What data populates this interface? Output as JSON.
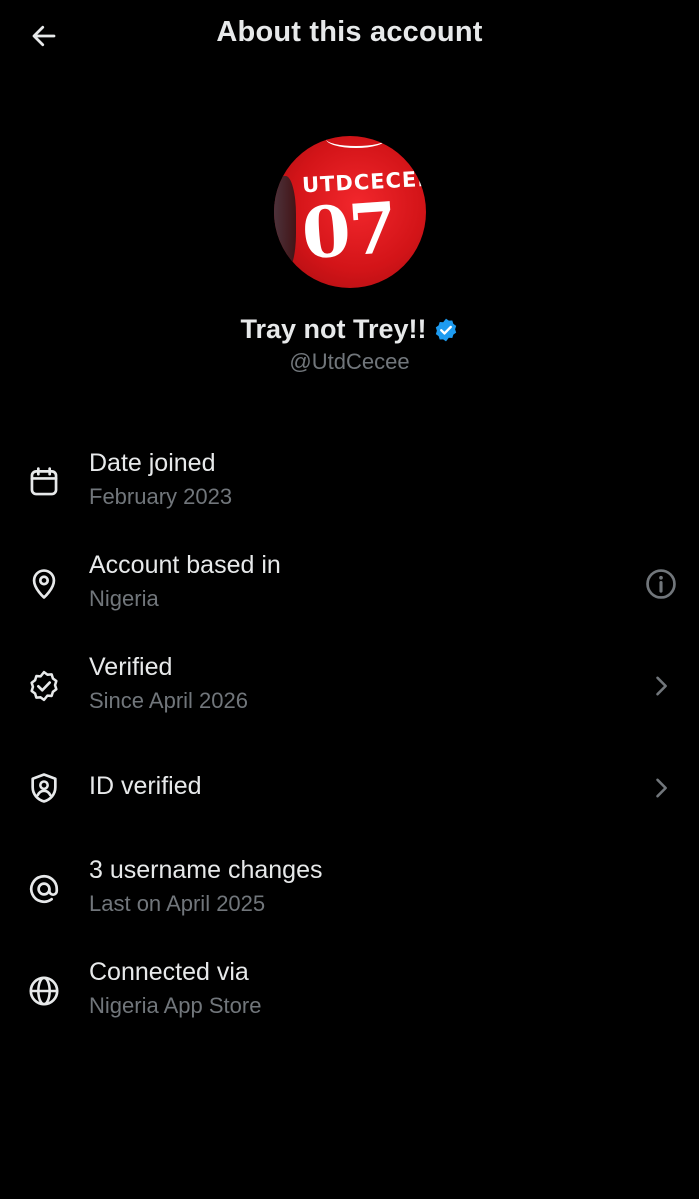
{
  "header": {
    "title": "About this account"
  },
  "profile": {
    "display_name": "Tray not Trey!!",
    "handle": "@UtdCecee",
    "avatar_jersey_name": "UTDCECEE",
    "avatar_jersey_number": "07",
    "verified_badge_color": "#1d9bf0"
  },
  "rows": [
    {
      "icon": "calendar-icon",
      "label": "Date joined",
      "sub": "February 2023"
    },
    {
      "icon": "location-pin-icon",
      "label": "Account based in",
      "sub": "Nigeria",
      "trail": "info-icon"
    },
    {
      "icon": "verified-check-icon",
      "label": "Verified",
      "sub": "Since April 2026",
      "trail": "chevron-right-icon"
    },
    {
      "icon": "id-shield-icon",
      "label": "ID verified",
      "trail": "chevron-right-icon"
    },
    {
      "icon": "at-sign-icon",
      "label": "3 username changes",
      "sub": "Last on April 2025"
    },
    {
      "icon": "globe-icon",
      "label": "Connected via",
      "sub": "Nigeria App Store"
    }
  ],
  "colors": {
    "background": "#000000",
    "primary_text": "#e7e9ea",
    "secondary_text": "#71767b",
    "accent": "#1d9bf0",
    "jersey_red": "#d31418"
  }
}
